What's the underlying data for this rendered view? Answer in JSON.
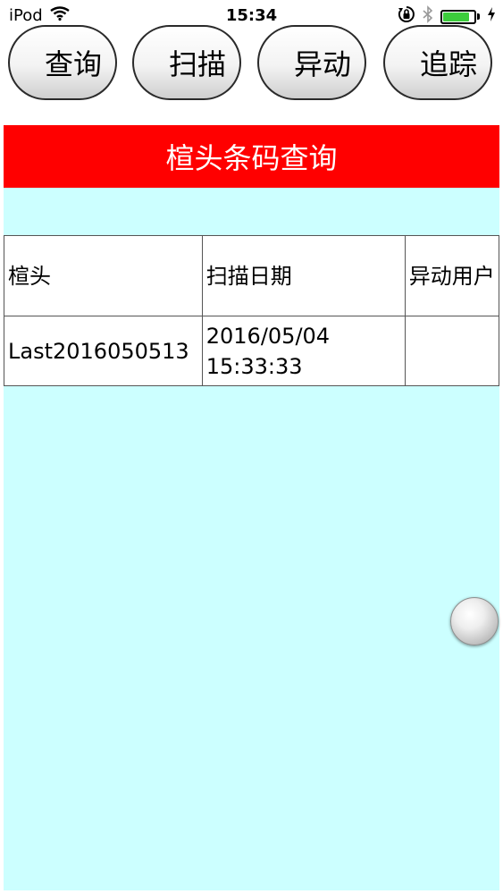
{
  "status_bar": {
    "carrier": "iPod",
    "time": "15:34",
    "icons": [
      "wifi-icon",
      "orientation-lock-icon",
      "bluetooth-icon",
      "battery-icon",
      "charging-icon"
    ],
    "battery_level": 0.85,
    "battery_color": "#3ccc3c"
  },
  "toolbar": {
    "buttons": [
      {
        "label": "查询"
      },
      {
        "label": "扫描"
      },
      {
        "label": "异动"
      },
      {
        "label": "追踪"
      }
    ]
  },
  "page": {
    "title": "楦头条码查询",
    "title_bg": "#ff0000",
    "content_bg": "#ccffff"
  },
  "table": {
    "headers": [
      "楦头",
      "扫描日期",
      "异动用户"
    ],
    "rows": [
      [
        "Last2016050513",
        "2016/05/04 15:33:33",
        ""
      ]
    ]
  }
}
